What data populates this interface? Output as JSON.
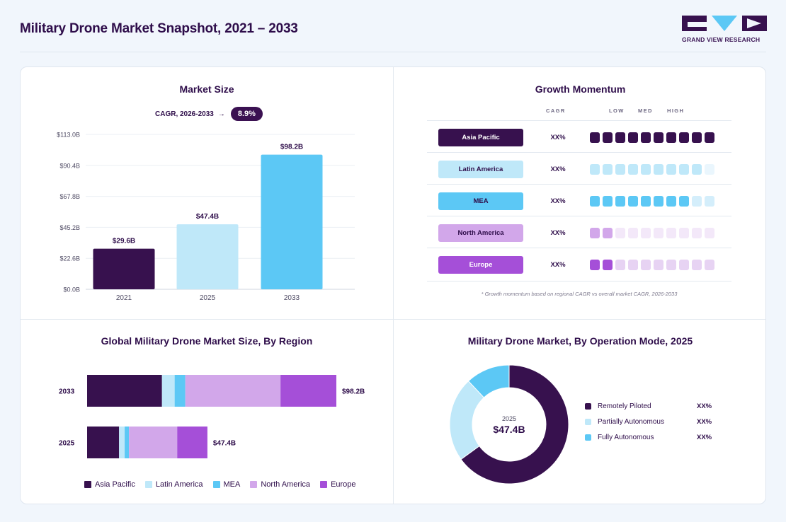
{
  "page": {
    "title": "Military Drone Market Snapshot, 2021 – 2033",
    "brand": "GRAND VIEW RESEARCH"
  },
  "colors": {
    "asia_pacific": "#37114e",
    "latin_america": "#bfe8f9",
    "mea": "#5cc8f5",
    "north_america": "#d2a7ea",
    "europe": "#a54fd8"
  },
  "market_size": {
    "title": "Market Size",
    "cagr_label": "CAGR, 2026-2033",
    "cagr_arrow": "→",
    "cagr_value": "8.9%"
  },
  "growth_momentum": {
    "title": "Growth Momentum",
    "head_cagr": "CAGR",
    "head_low": "LOW",
    "head_med": "MED",
    "head_high": "HIGH",
    "rows": [
      {
        "label": "Asia Pacific",
        "value": "XX%",
        "level": 10,
        "label_bg": "#37114e",
        "label_fg": "#ffffff",
        "on": "#37114e",
        "off": "#ede3f4"
      },
      {
        "label": "Latin America",
        "value": "XX%",
        "level": 9,
        "label_bg": "#bfe8f9",
        "label_fg": "#2e0d4a",
        "on": "#bfe8f9",
        "off": "#eaf6fd"
      },
      {
        "label": "MEA",
        "value": "XX%",
        "level": 8,
        "label_bg": "#5cc8f5",
        "label_fg": "#2e0d4a",
        "on": "#5cc8f5",
        "off": "#d4eefb"
      },
      {
        "label": "North America",
        "value": "XX%",
        "level": 2,
        "label_bg": "#d2a7ea",
        "label_fg": "#2e0d4a",
        "on": "#d2a7ea",
        "off": "#f3e8f9"
      },
      {
        "label": "Europe",
        "value": "XX%",
        "level": 2,
        "label_bg": "#a54fd8",
        "label_fg": "#ffffff",
        "on": "#a54fd8",
        "off": "#e7d3f3"
      }
    ],
    "note": "* Growth momentum based on regional CAGR vs overall market CAGR, 2026-2033"
  },
  "region": {
    "title": "Global Military Drone Market Size, By Region"
  },
  "operation_mode": {
    "title": "Military Drone Market, By Operation Mode, 2025",
    "center_year": "2025",
    "center_value": "$47.4B",
    "legend": [
      {
        "name": "Remotely Piloted",
        "value": "XX%",
        "color": "#37114e"
      },
      {
        "name": "Partially Autonomous",
        "value": "XX%",
        "color": "#bfe8f9"
      },
      {
        "name": "Fully Autonomous",
        "value": "XX%",
        "color": "#5cc8f5"
      }
    ]
  },
  "chart_data": [
    {
      "type": "bar",
      "title": "Market Size",
      "categories": [
        "2021",
        "2025",
        "2033"
      ],
      "values": [
        29.6,
        47.4,
        98.2
      ],
      "value_labels": [
        "$29.6B",
        "$47.4B",
        "$98.2B"
      ],
      "bar_colors": [
        "#37114e",
        "#bfe8f9",
        "#5cc8f5"
      ],
      "ylim": [
        0,
        113.0
      ],
      "yticks": [
        0,
        22.6,
        45.2,
        67.8,
        90.4,
        113.0
      ],
      "ytick_labels": [
        "$0.0B",
        "$22.6B",
        "$45.2B",
        "$67.8B",
        "$90.4B",
        "$113.0B"
      ],
      "grid": true
    },
    {
      "type": "bar",
      "orientation": "horizontal-stacked",
      "title": "Global Military Drone Market Size, By Region",
      "categories": [
        "2033",
        "2025"
      ],
      "totals": [
        98.2,
        47.4
      ],
      "total_labels": [
        "$98.2B",
        "$47.4B"
      ],
      "series": [
        {
          "name": "Asia Pacific",
          "values": [
            29.5,
            12.6
          ]
        },
        {
          "name": "Latin America",
          "values": [
            5.0,
            2.2
          ]
        },
        {
          "name": "MEA",
          "values": [
            4.2,
            1.7
          ]
        },
        {
          "name": "North America",
          "values": [
            37.5,
            19.0
          ]
        },
        {
          "name": "Europe",
          "values": [
            22.0,
            11.9
          ]
        }
      ],
      "legend": "bottom"
    },
    {
      "type": "pie",
      "variant": "donut",
      "title": "Military Drone Market, By Operation Mode, 2025",
      "categories": [
        "Remotely Piloted",
        "Partially Autonomous",
        "Fully Autonomous"
      ],
      "values": [
        0.65,
        0.23,
        0.12
      ],
      "legend": "right"
    }
  ]
}
